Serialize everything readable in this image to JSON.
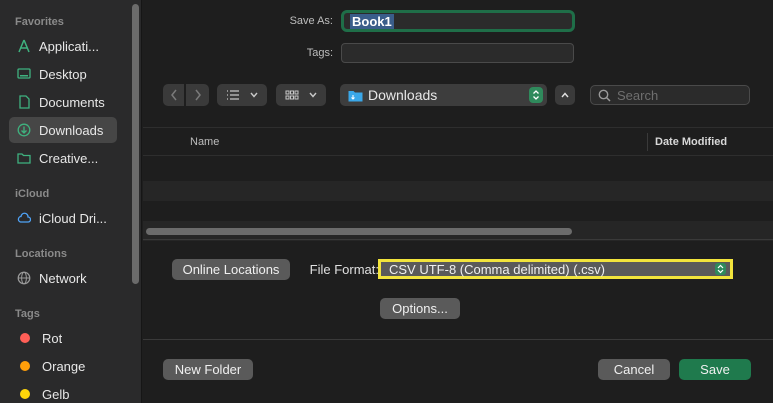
{
  "sidebar": {
    "sections": {
      "favorites": "Favorites",
      "icloud": "iCloud",
      "locations": "Locations",
      "tags": "Tags"
    },
    "favorites": [
      {
        "label": "Applicati...",
        "icon": "applications-icon"
      },
      {
        "label": "Desktop",
        "icon": "desktop-icon"
      },
      {
        "label": "Documents",
        "icon": "document-icon"
      },
      {
        "label": "Downloads",
        "icon": "downloads-icon",
        "selected": true
      },
      {
        "label": "Creative...",
        "icon": "folder-icon"
      }
    ],
    "icloud": [
      {
        "label": "iCloud Dri...",
        "icon": "cloud-icon"
      }
    ],
    "locations": [
      {
        "label": "Network",
        "icon": "network-icon"
      }
    ],
    "tags": [
      {
        "label": "Rot",
        "color": "#ff5f57"
      },
      {
        "label": "Orange",
        "color": "#ff9f0a"
      },
      {
        "label": "Gelb",
        "color": "#ffd60a"
      }
    ]
  },
  "form": {
    "save_as_label": "Save As:",
    "save_as_value": "Book1",
    "tags_label": "Tags:",
    "tags_value": ""
  },
  "toolbar": {
    "location": "Downloads",
    "search_placeholder": "Search"
  },
  "list": {
    "col_name": "Name",
    "col_date": "Date Modified"
  },
  "options": {
    "online_locations": "Online Locations",
    "file_format_label": "File Format:",
    "file_format_value": "CSV UTF-8 (Comma delimited) (.csv)",
    "options_button": "Options..."
  },
  "footer": {
    "new_folder": "New Folder",
    "cancel": "Cancel",
    "save": "Save"
  },
  "colors": {
    "accent": "#1f7a4d",
    "highlight": "#f2e43c"
  }
}
